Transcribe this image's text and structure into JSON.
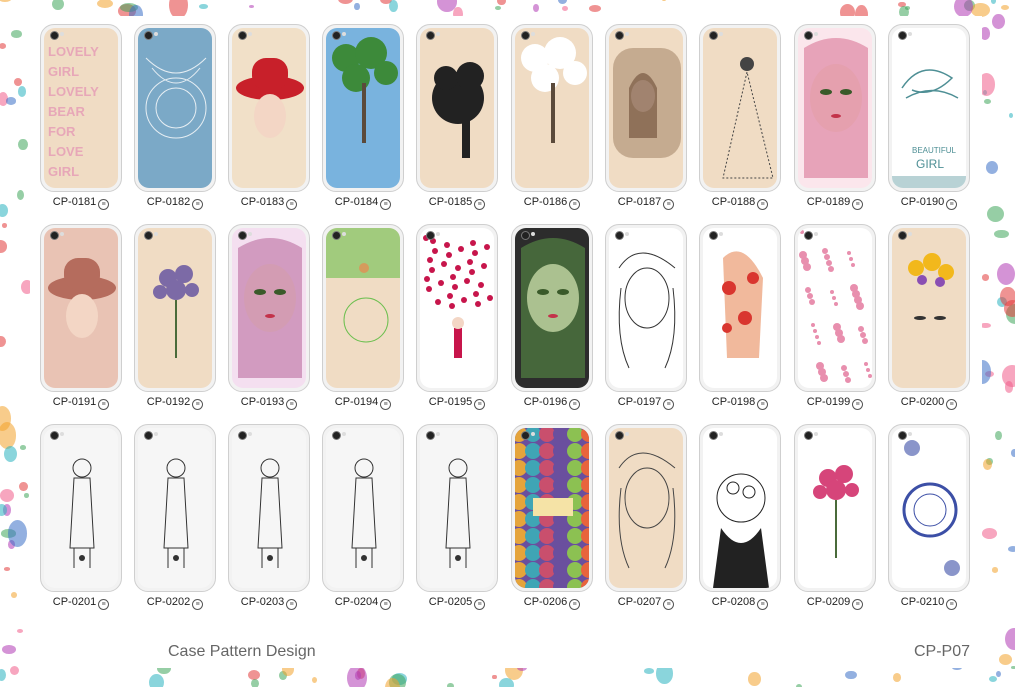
{
  "footer": {
    "title": "Case Pattern Design",
    "code": "CP-P07"
  },
  "rows": [
    {
      "items": [
        {
          "code": "CP-0181",
          "bg": "#f0dcc4",
          "accent": "#e7a7b8",
          "motif": "text"
        },
        {
          "code": "CP-0182",
          "bg": "#7ba9c7",
          "accent": "#e6eef3",
          "motif": "lace"
        },
        {
          "code": "CP-0183",
          "bg": "#f1e0c8",
          "accent": "#c8202a",
          "motif": "hat"
        },
        {
          "code": "CP-0184",
          "bg": "#79b3de",
          "accent": "#3d8a3a",
          "motif": "tree"
        },
        {
          "code": "CP-0185",
          "bg": "#f0dcc4",
          "accent": "#222222",
          "motif": "silhouette"
        },
        {
          "code": "CP-0186",
          "bg": "#f0dcc4",
          "accent": "#ffffff",
          "motif": "tree"
        },
        {
          "code": "CP-0187",
          "bg": "#f0dcc4",
          "accent": "#a88a6e",
          "motif": "portrait"
        },
        {
          "code": "CP-0188",
          "bg": "#f0dcc4",
          "accent": "#444444",
          "motif": "dress"
        },
        {
          "code": "CP-0189",
          "bg": "#fbe6ec",
          "accent": "#d45f86",
          "motif": "face"
        },
        {
          "code": "CP-0190",
          "bg": "#ffffff",
          "accent": "#4e8f95",
          "motif": "girl"
        }
      ]
    },
    {
      "items": [
        {
          "code": "CP-0191",
          "bg": "#e9c3b4",
          "accent": "#b56c5d",
          "motif": "hat"
        },
        {
          "code": "CP-0192",
          "bg": "#f0dcc4",
          "accent": "#7c6aa6",
          "motif": "bouquet"
        },
        {
          "code": "CP-0193",
          "bg": "#f4dff0",
          "accent": "#b0578f",
          "motif": "face"
        },
        {
          "code": "CP-0194",
          "bg": "#f0dcc4",
          "accent": "#6cbf4f",
          "motif": "swing"
        },
        {
          "code": "CP-0195",
          "bg": "#ffffff",
          "accent": "#c7154b",
          "motif": "hearts"
        },
        {
          "code": "CP-0196",
          "bg": "#2c2c2c",
          "accent": "#5fa24a",
          "motif": "face"
        },
        {
          "code": "CP-0197",
          "bg": "#ffffff",
          "accent": "#333333",
          "motif": "sketch"
        },
        {
          "code": "CP-0198",
          "bg": "#ffffff",
          "accent": "#d9362f",
          "motif": "poppies"
        },
        {
          "code": "CP-0199",
          "bg": "#ffffff",
          "accent": "#e88fae",
          "motif": "blossom"
        },
        {
          "code": "CP-0200",
          "bg": "#f0dcc4",
          "accent": "#f2b81c",
          "motif": "flowers"
        }
      ]
    },
    {
      "items": [
        {
          "code": "CP-0201",
          "bg": "#f6f6f6",
          "accent": "#333333",
          "motif": "floral-girl"
        },
        {
          "code": "CP-0202",
          "bg": "#f6f6f6",
          "accent": "#333333",
          "motif": "floral-girl"
        },
        {
          "code": "CP-0203",
          "bg": "#f6f6f6",
          "accent": "#333333",
          "motif": "floral-girl"
        },
        {
          "code": "CP-0204",
          "bg": "#f6f6f6",
          "accent": "#333333",
          "motif": "floral-girl"
        },
        {
          "code": "CP-0205",
          "bg": "#f6f6f6",
          "accent": "#333333",
          "motif": "floral-girl"
        },
        {
          "code": "CP-0206",
          "bg": "#6a4f9e",
          "accent": "#e5a43b",
          "motif": "geometric"
        },
        {
          "code": "CP-0207",
          "bg": "#f0dcc4",
          "accent": "#444444",
          "motif": "sketch"
        },
        {
          "code": "CP-0208",
          "bg": "#ffffff",
          "accent": "#222222",
          "motif": "bloom-head"
        },
        {
          "code": "CP-0209",
          "bg": "#ffffff",
          "accent": "#d6457a",
          "motif": "bouquet"
        },
        {
          "code": "CP-0210",
          "bg": "#ffffff",
          "accent": "#3c4fa6",
          "motif": "porcelain"
        }
      ]
    }
  ]
}
